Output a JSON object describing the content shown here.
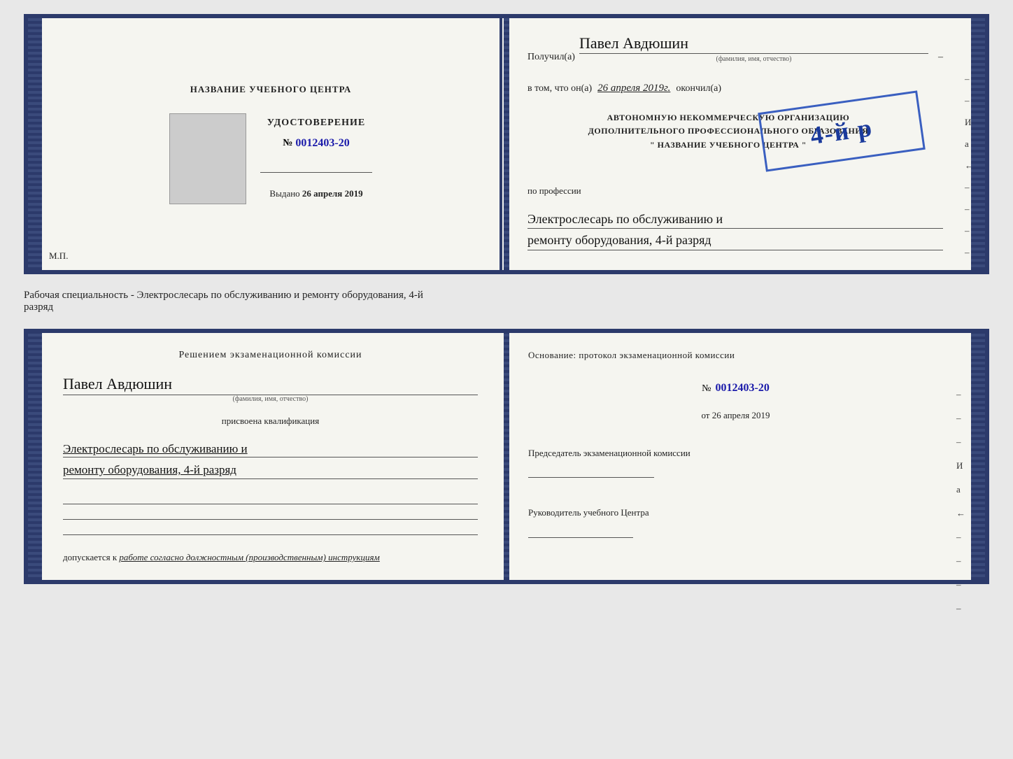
{
  "top_booklet": {
    "left_page": {
      "center_title": "НАЗВАНИЕ УЧЕБНОГО ЦЕНТРА",
      "photo_alt": "фото",
      "udostoverenie": "УДОСТОВЕРЕНИЕ",
      "number_prefix": "№",
      "number": "0012403-20",
      "issue_label": "Выдано",
      "issue_date": "26 апреля 2019",
      "mp_label": "М.П."
    },
    "right_page": {
      "poluchil_prefix": "Получил(а)",
      "recipient_name": "Павел Авдюшин",
      "fio_subtitle": "(фамилия, имя, отчество)",
      "dash": "–",
      "vtom_prefix": "в том, что он(а)",
      "vtom_date": "26 апреля 2019г.",
      "okonchil": "окончил(а)",
      "stamp_number": "4-й р",
      "stamp_line1": "АВТОНОМНУЮ НЕКОММЕРЧЕСКУЮ ОРГАНИЗАЦИЮ",
      "stamp_line2": "ДОПОЛНИТЕЛЬНОГО ПРОФЕССИОНАЛЬНОГО ОБРАЗОВАНИЯ",
      "stamp_line3": "\" НАЗВАНИЕ УЧЕБНОГО ЦЕНТРА \"",
      "po_professii": "по профессии",
      "profession_line1": "Электрослесарь по обслуживанию и",
      "profession_line2": "ремонту оборудования, 4-й разряд",
      "right_chars": [
        "–",
        "–",
        "И",
        "а",
        "←",
        "–",
        "–",
        "–",
        "–"
      ]
    }
  },
  "middle_text": {
    "line1": "Рабочая специальность - Электрослесарь по обслуживанию и ремонту оборудования, 4-й",
    "line2": "разряд"
  },
  "bottom_booklet": {
    "left_page": {
      "decision_title": "Решением экзаменационной  комиссии",
      "person_name": "Павел Авдюшин",
      "fio_subtitle": "(фамилия, имя, отчество)",
      "prisvoena": "присвоена квалификация",
      "qualification_line1": "Электрослесарь по обслуживанию и",
      "qualification_line2": "ремонту оборудования, 4-й разряд",
      "dopuskaetsya_prefix": "допускается к",
      "dopuskaetsya_text": "работе согласно должностным (производственным) инструкциям",
      "signature_lines": 3
    },
    "right_page": {
      "osnovaniye_text": "Основание: протокол экзаменационной  комиссии",
      "number_prefix": "№",
      "protocol_number": "0012403-20",
      "date_prefix": "от",
      "protocol_date": "26 апреля 2019",
      "chairman_title": "Председатель экзаменационной комиссии",
      "director_title": "Руководитель учебного Центра",
      "right_chars": [
        "–",
        "–",
        "–",
        "И",
        "а",
        "←",
        "–",
        "–",
        "–",
        "–"
      ]
    }
  }
}
